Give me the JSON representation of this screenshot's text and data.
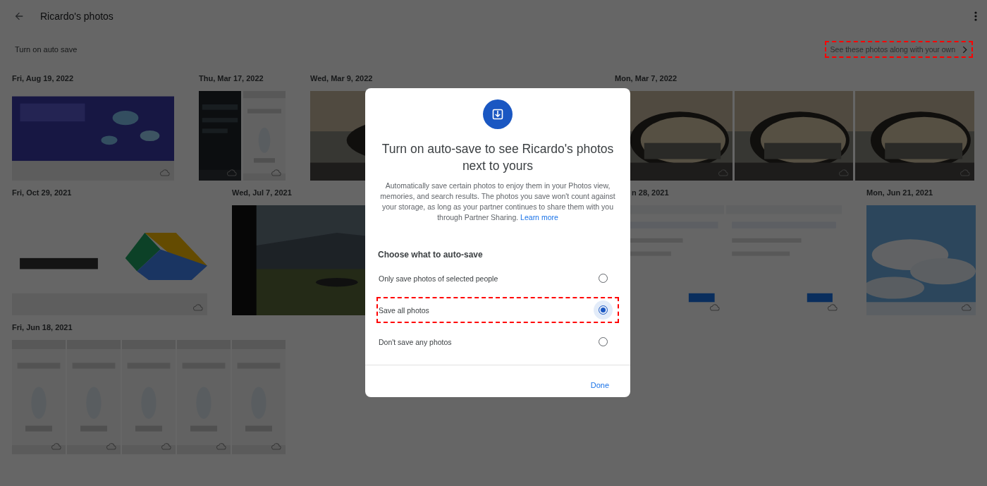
{
  "header": {
    "title": "Ricardo's photos"
  },
  "banner": {
    "text": "Turn on auto save",
    "link": {
      "label": "See these photos along with your own",
      "highlighted": true
    }
  },
  "photo_rows": [
    [
      {
        "date": "Fri, Aug 19, 2022"
      },
      {
        "date": "Thu, Mar 17, 2022"
      },
      {
        "date": "Wed, Mar 9, 2022"
      },
      {
        "date": "Mon, Mar 7, 2022"
      }
    ],
    [
      {
        "date": "Fri, Oct 29, 2021"
      },
      {
        "date": "Wed, Jul 7, 2021"
      },
      {
        "date": "n 28, 2021"
      },
      {
        "date": "Mon, Jun 21, 2021"
      }
    ],
    [
      {
        "date": "Fri, Jun 18, 2021"
      }
    ]
  ],
  "dialog": {
    "title": "Turn on auto-save to see Ricardo's photos next to yours",
    "description": "Automatically save certain photos to enjoy them in your Photos view, memories, and search results. The photos you save won't count against your storage, as long as your partner continues to share them with you through Partner Sharing.",
    "learn_more": "Learn more",
    "section_label": "Choose what to auto-save",
    "options": [
      {
        "label": "Only save photos of selected people",
        "selected": false,
        "highlighted": false
      },
      {
        "label": "Save all photos",
        "selected": true,
        "highlighted": true
      },
      {
        "label": "Don't save any photos",
        "selected": false,
        "highlighted": false
      }
    ],
    "done": "Done"
  }
}
